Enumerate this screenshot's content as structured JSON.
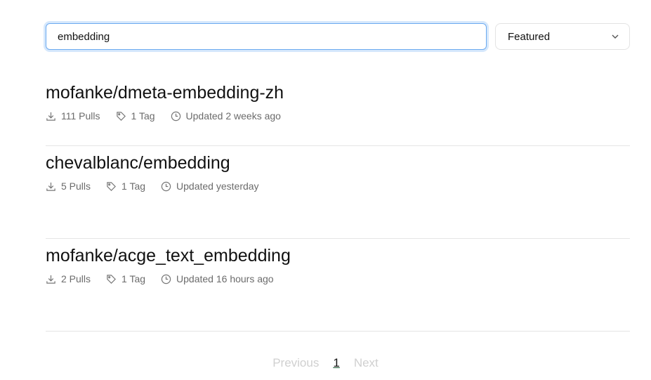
{
  "search": {
    "value": "embedding"
  },
  "sort": {
    "selected": "Featured"
  },
  "results": [
    {
      "name": "mofanke/dmeta-embedding-zh",
      "pulls": "111 Pulls",
      "tags": "1 Tag",
      "updated": "Updated 2 weeks ago"
    },
    {
      "name": "chevalblanc/embedding",
      "pulls": "5 Pulls",
      "tags": "1 Tag",
      "updated": "Updated yesterday"
    },
    {
      "name": "mofanke/acge_text_embedding",
      "pulls": "2 Pulls",
      "tags": "1 Tag",
      "updated": "Updated 16 hours ago"
    }
  ],
  "pagination": {
    "previous": "Previous",
    "current": "1",
    "next": "Next"
  }
}
